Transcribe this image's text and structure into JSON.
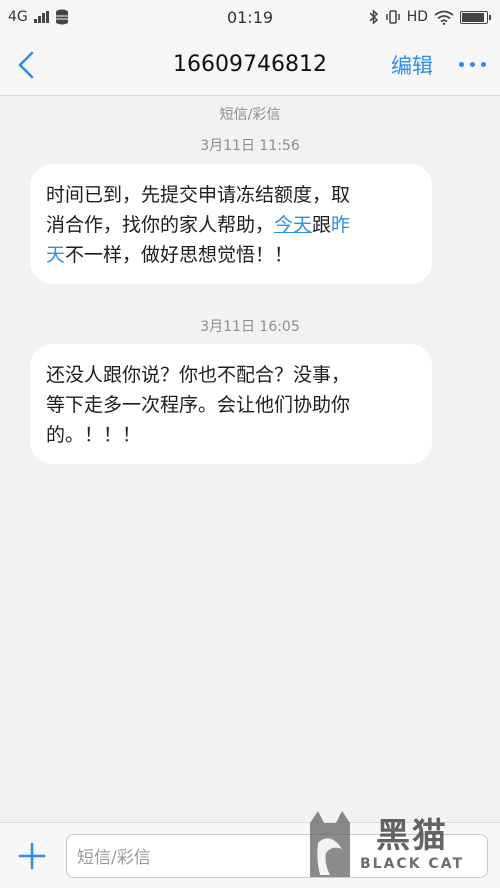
{
  "status_bar": {
    "network": "4G",
    "time": "01:19",
    "hd": "HD"
  },
  "header": {
    "contact": "16609746812",
    "edit_label": "编辑",
    "icons": {
      "back": "chevron-left-icon",
      "more": "more-dots-icon"
    }
  },
  "thread": {
    "type_label": "短信/彩信",
    "messages": [
      {
        "timestamp": "3月11日 11:56",
        "line1": "时间已到，先提交申请冻结额度，取",
        "line2_a": "消合作，找你的家人帮助，",
        "line2_link": "今天",
        "line2_b": "跟",
        "line2_link2": "昨",
        "line3_link": "天",
        "line3_b": "不一样，做好思想觉悟！！"
      },
      {
        "timestamp": "3月11日 16:05",
        "line1": " 还没人跟你说？你也不配合？没事，",
        "line2": "等下走多一次程序。会让他们协助你",
        "line3": "的。！！！"
      }
    ]
  },
  "composer": {
    "placeholder": "短信/彩信"
  },
  "watermark": {
    "cn": "黑猫",
    "en": "BLACK CAT"
  },
  "colors": {
    "accent": "#2f8ee6",
    "background": "#f2f2f4",
    "bubble": "#ffffff"
  }
}
